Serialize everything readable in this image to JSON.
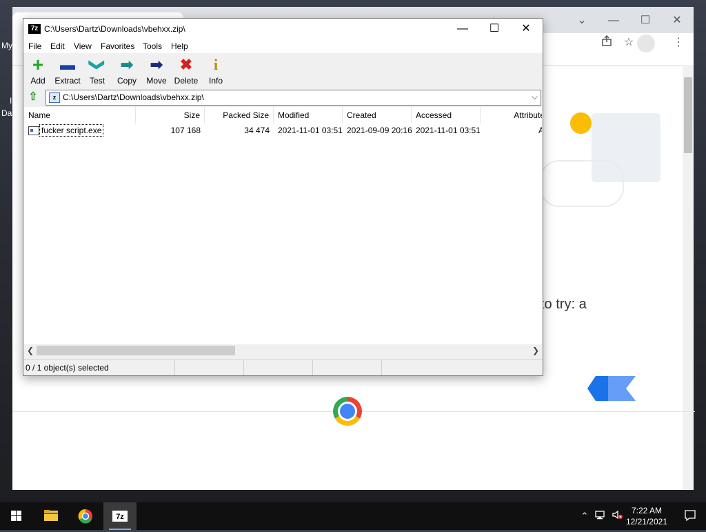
{
  "desktop": {
    "label_my": "My",
    "label_da": "Da",
    "label_i": "I"
  },
  "chrome": {
    "min": "⌄",
    "restore": "☐",
    "close": "✕",
    "ntp_text": "to try: a",
    "share_icon": "share-icon",
    "star_icon": "star-icon",
    "menu_icon": "kebab-menu-icon"
  },
  "zip": {
    "title": "C:\\Users\\Dartz\\Downloads\\vbehxx.zip\\",
    "title_icon": "7z",
    "min": "—",
    "max": "☐",
    "close": "✕",
    "menu": [
      "File",
      "Edit",
      "View",
      "Favorites",
      "Tools",
      "Help"
    ],
    "toolbar": [
      {
        "label": "Add",
        "icon": "+",
        "color": "#1fa81f"
      },
      {
        "label": "Extract",
        "icon": "▬",
        "color": "#1a3fa8"
      },
      {
        "label": "Test",
        "icon": "❯",
        "color": "#19a3a3"
      },
      {
        "label": "Copy",
        "icon": "➡",
        "color": "#1a8a8a"
      },
      {
        "label": "Move",
        "icon": "➡",
        "color": "#1a2a80"
      },
      {
        "label": "Delete",
        "icon": "✖",
        "color": "#d81e1e"
      },
      {
        "label": "Info",
        "icon": "i",
        "color": "#b89000"
      }
    ],
    "address": "C:\\Users\\Dartz\\Downloads\\vbehxx.zip\\",
    "columns": [
      "Name",
      "Size",
      "Packed Size",
      "Modified",
      "Created",
      "Accessed",
      "Attribute"
    ],
    "rows": [
      {
        "name": "fucker script.exe",
        "size": "107 168",
        "packed": "34 474",
        "modified": "2021-11-01 03:51",
        "created": "2021-09-09 20:16",
        "accessed": "2021-11-01 03:51",
        "attr": "A"
      }
    ],
    "status": "0 / 1 object(s) selected"
  },
  "taskbar": {
    "time": "7:22 AM",
    "date": "12/21/2021"
  }
}
